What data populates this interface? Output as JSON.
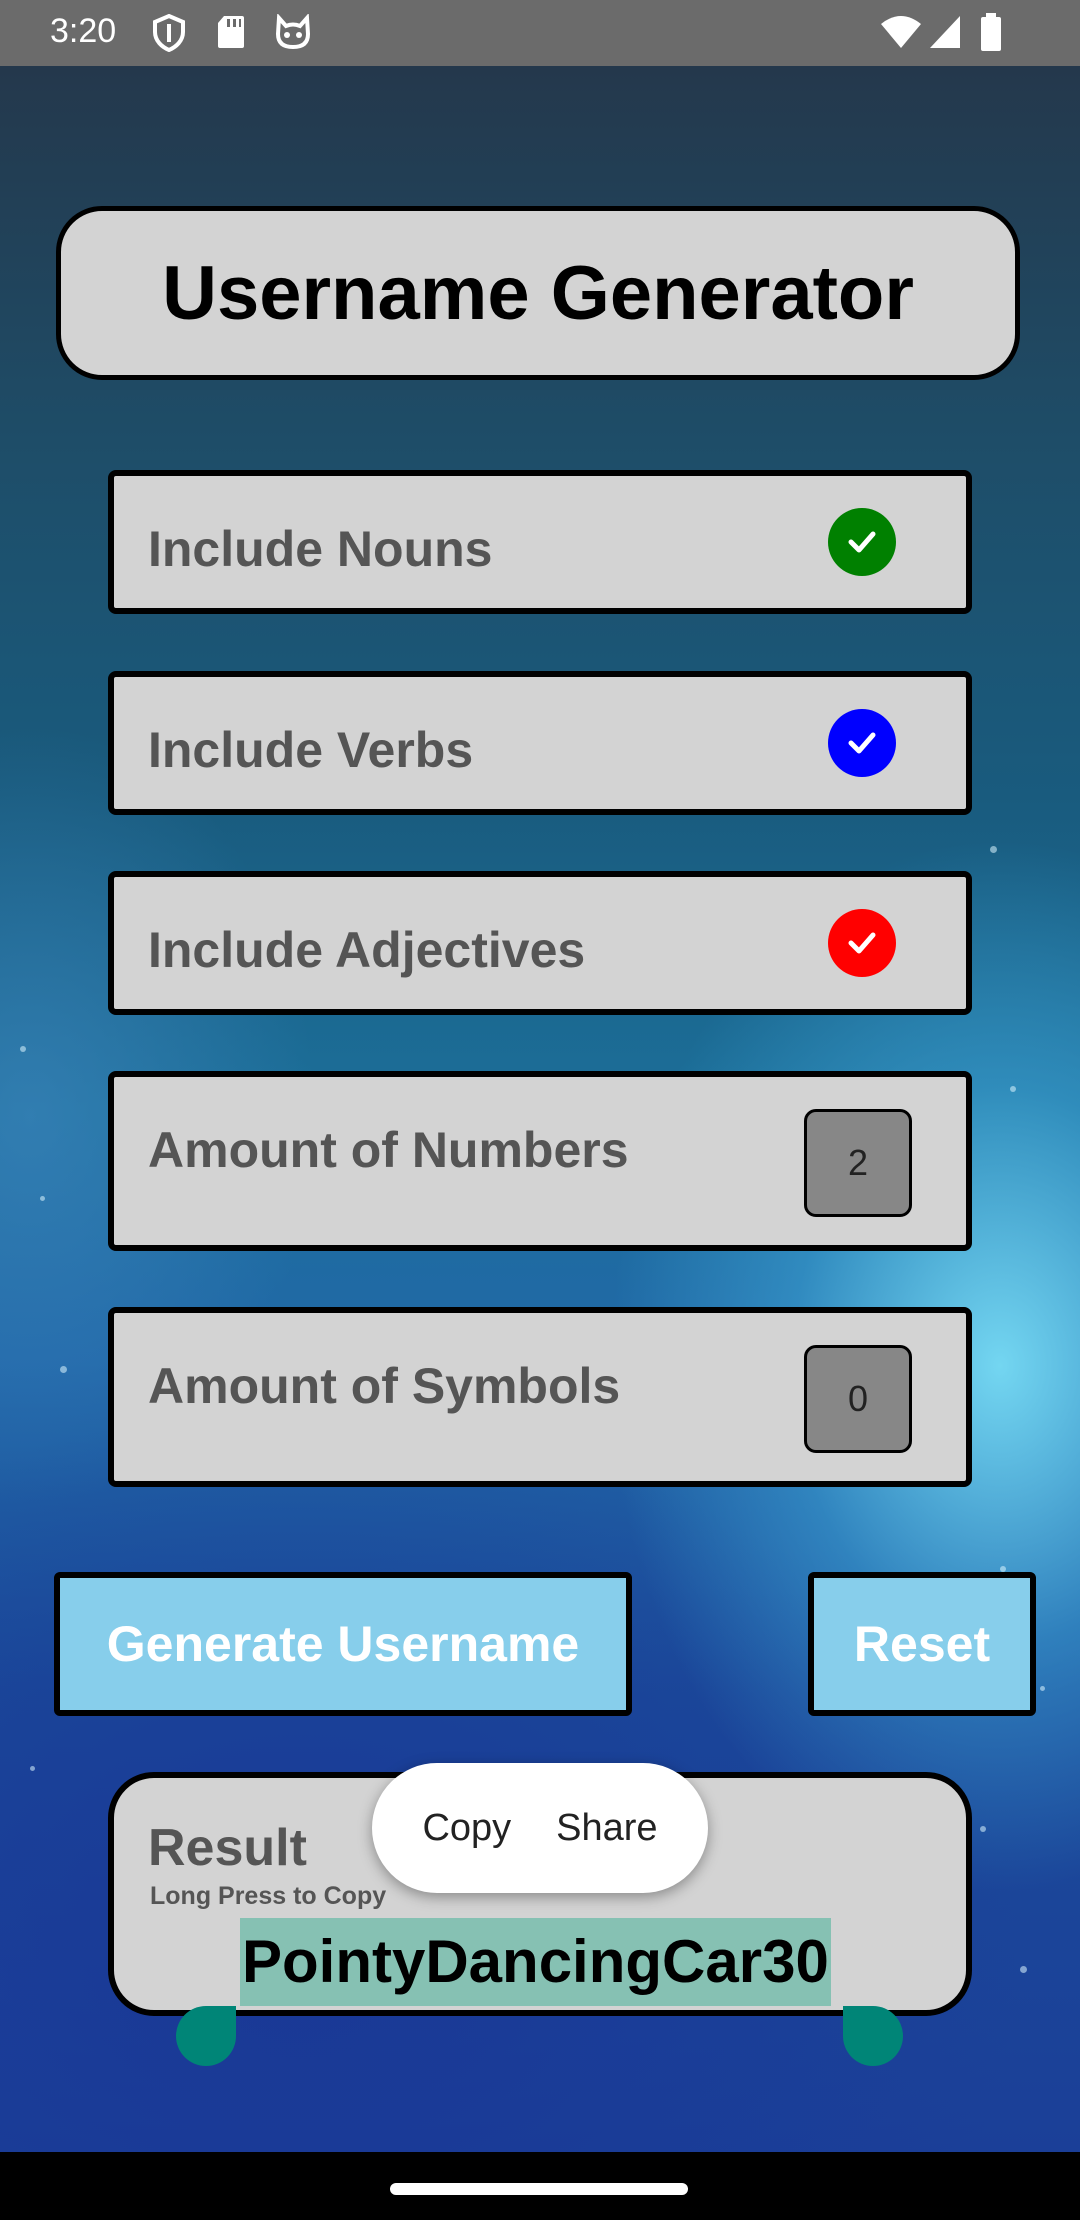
{
  "status_bar": {
    "time": "3:20",
    "left_icons": [
      "shield-icon",
      "sd-card-icon",
      "cat-face-icon"
    ],
    "right_icons": [
      "wifi-icon",
      "signal-icon",
      "battery-icon"
    ]
  },
  "header": {
    "title": "Username Generator"
  },
  "options": [
    {
      "label": "Include Nouns",
      "checked": true,
      "color": "#008000"
    },
    {
      "label": "Include Verbs",
      "checked": true,
      "color": "#0000ff"
    },
    {
      "label": "Include Adjectives",
      "checked": true,
      "color": "#ff0000"
    }
  ],
  "amounts": {
    "numbers": {
      "label": "Amount of Numbers",
      "value": "2"
    },
    "symbols": {
      "label": "Amount of Symbols",
      "value": "0"
    }
  },
  "actions": {
    "generate_label": "Generate Username",
    "reset_label": "Reset",
    "button_color": "#87ceeb"
  },
  "result": {
    "title": "Result",
    "hint": "Long Press to Copy",
    "value": "PointyDancingCar30",
    "selection_color": "#86c1b3"
  },
  "context_menu": {
    "copy": "Copy",
    "share": "Share"
  },
  "colors": {
    "panel": "#d3d3d3",
    "handle": "#008577"
  }
}
